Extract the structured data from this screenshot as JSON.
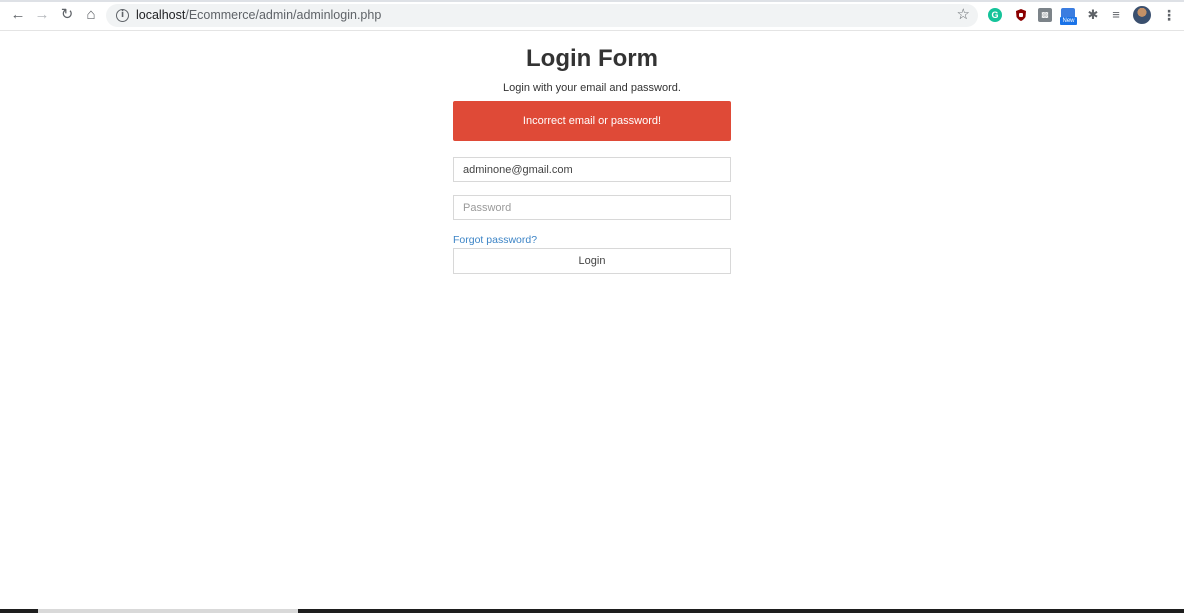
{
  "browser": {
    "url_host": "localhost",
    "url_path": "/Ecommerce/admin/adminlogin.php",
    "icons": [
      "back-arrow-icon",
      "forward-arrow-icon",
      "reload-icon",
      "home-icon",
      "info-icon",
      "star-icon",
      "grammarly-icon",
      "ublock-icon",
      "extension-box-icon",
      "new-extension-icon",
      "puzzle-icon",
      "reading-list-icon",
      "profile-avatar",
      "kebab-menu-icon"
    ],
    "new_badge": "New"
  },
  "login": {
    "title": "Login Form",
    "subtitle": "Login with your email and password.",
    "alert": "Incorrect email or password!",
    "email_value": "adminone@gmail.com",
    "password_placeholder": "Password",
    "forgot_label": "Forgot password?",
    "login_label": "Login"
  },
  "colors": {
    "alert_bg": "#df4a37",
    "link": "#3c84c6"
  }
}
